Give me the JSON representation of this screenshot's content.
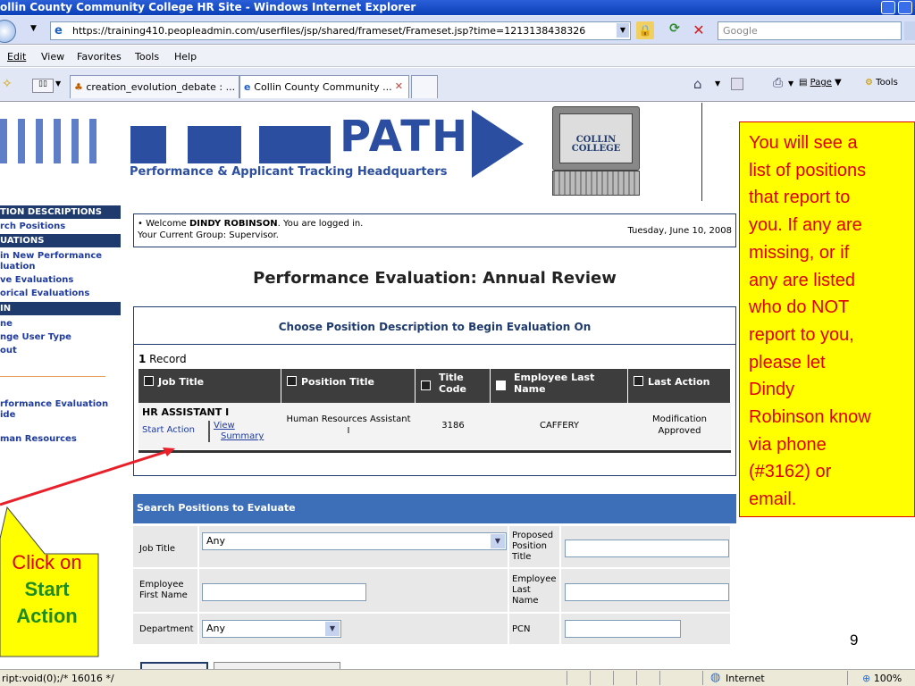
{
  "window": {
    "title": "ollin County Community College HR Site - Windows Internet Explorer",
    "address": "https://training410.peopleadmin.com/userfiles/jsp/shared/frameset/Frameset.jsp?time=1213138438326",
    "search_placeholder": "Google"
  },
  "menu": [
    "Edit",
    "View",
    "Favorites",
    "Tools",
    "Help"
  ],
  "tabs": [
    "creation_evolution_debate : ...",
    "Collin County Community ..."
  ],
  "toolbar_right": {
    "page": "Page",
    "tools": "Tools"
  },
  "banner": {
    "logo": "PATH",
    "tagline": "Performance & Applicant Tracking Headquarters",
    "college_line1": "COLLIN",
    "college_line2": "COLLEGE"
  },
  "sidebar": {
    "header1": "TION DESCRIPTIONS",
    "link1": "rch Positions",
    "header2": "UATIONS",
    "links2": [
      "in New Performance",
      "luation",
      "ve Evaluations",
      "orical Evaluations"
    ],
    "header3": "IN",
    "links3": [
      "ne",
      "nge User Type",
      "out"
    ],
    "links4": [
      "rformance Evaluation",
      "ide",
      "man Resources"
    ]
  },
  "welcome": {
    "prefix": "• Welcome ",
    "name": "DINDY ROBINSON",
    "suffix": ". You are logged in.",
    "group": "Your Current Group: Supervisor.",
    "date": "Tuesday, June 10, 2008"
  },
  "page_title": "Performance Evaluation: Annual Review",
  "choose_heading": "Choose Position Description to Begin Evaluation On",
  "records": {
    "count": "1",
    "label": " Record"
  },
  "table": {
    "columns": [
      "Job Title",
      "Position Title",
      "Title Code",
      "Employee Last Name",
      "Last Action"
    ],
    "row": {
      "job_title": "HR ASSISTANT I",
      "start_action": "Start Action",
      "view_summary_1": "View",
      "view_summary_2": "Summary",
      "position_title_1": "Human Resources Assistant",
      "position_title_2": "I",
      "title_code": "3186",
      "last_name": "CAFFERY",
      "last_action_1": "Modification",
      "last_action_2": "Approved"
    }
  },
  "search": {
    "heading": "Search Positions to Evaluate",
    "job_title_label": "Job Title",
    "job_title_value": "Any",
    "proposed_label_1": "Proposed",
    "proposed_label_2": "Position",
    "proposed_label_3": "Title",
    "first_name_label_1": "Employee",
    "first_name_label_2": "First Name",
    "last_name_label_1": "Employee",
    "last_name_label_2": "Last",
    "last_name_label_3": "Name",
    "department_label": "Department",
    "department_value": "Any",
    "pcn_label": "PCN"
  },
  "callout_right": [
    "You will see a",
    "list of positions",
    "that report to",
    "you. If any are",
    "missing, or if",
    "any are listed",
    "who do NOT",
    "report to you,",
    "please let",
    "Dindy",
    "Robinson know",
    "via phone",
    "(#3162) or",
    "email."
  ],
  "callout_left": [
    "Click on",
    "Start",
    "Action"
  ],
  "slide_number": "9",
  "status": {
    "text": "ript:void(0);/* 16016 */",
    "zone": "Internet",
    "zoom": "100%"
  },
  "colors": {
    "accent_blue": "#1f3b6e",
    "callout_yellow": "#ffff00",
    "callout_red": "#dd0000",
    "callout_green": "#1e8c1e"
  }
}
